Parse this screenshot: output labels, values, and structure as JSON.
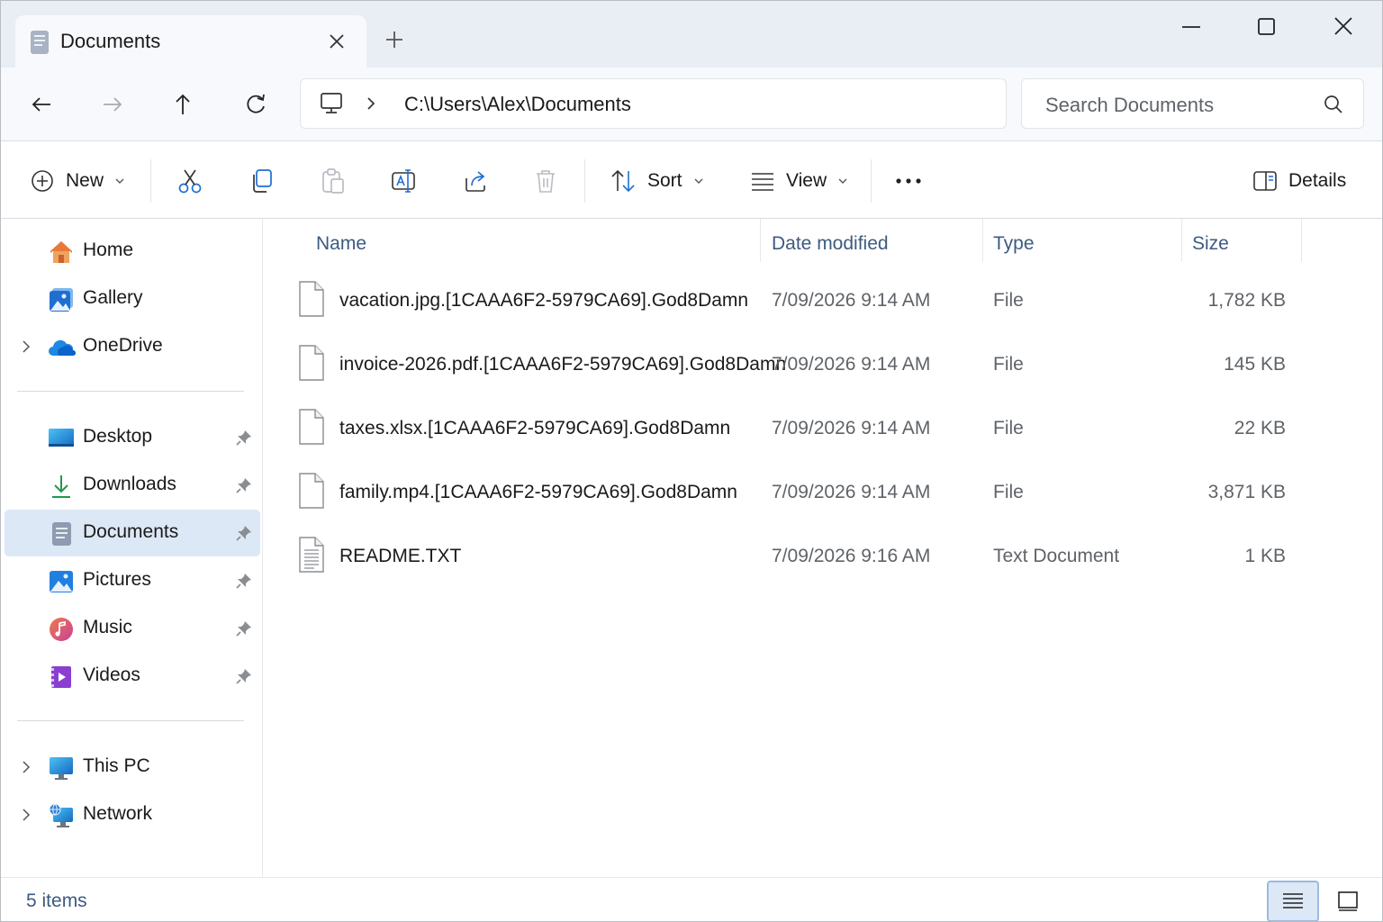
{
  "window": {
    "tab_title": "Documents",
    "tab_icon": "documents-icon",
    "controls": [
      "minimize-icon",
      "maximize-icon",
      "close-icon"
    ]
  },
  "address": {
    "path": "C:\\Users\\Alex\\Documents",
    "location_icon": "pc-icon",
    "search_placeholder": "Search Documents"
  },
  "toolbar": {
    "new_label": "New",
    "sort_label": "Sort",
    "view_label": "View",
    "details_label": "Details",
    "actions": [
      "cut-icon",
      "copy-icon",
      "paste-icon",
      "rename-icon",
      "share-icon",
      "delete-icon",
      "more-icon"
    ]
  },
  "sidebar": {
    "items": [
      {
        "label": "Home",
        "icon": "home-icon"
      },
      {
        "label": "Gallery",
        "icon": "gallery-icon"
      },
      {
        "label": "OneDrive",
        "icon": "onedrive-icon",
        "expandable": true
      },
      {
        "label": "Desktop",
        "icon": "desktop-icon",
        "pinned": true
      },
      {
        "label": "Downloads",
        "icon": "downloads-icon",
        "pinned": true
      },
      {
        "label": "Documents",
        "icon": "documents-icon",
        "pinned": true,
        "selected": true
      },
      {
        "label": "Pictures",
        "icon": "pictures-icon",
        "pinned": true
      },
      {
        "label": "Music",
        "icon": "music-icon",
        "pinned": true
      },
      {
        "label": "Videos",
        "icon": "videos-icon",
        "pinned": true
      },
      {
        "label": "This PC",
        "icon": "this-pc-icon",
        "expandable": true
      },
      {
        "label": "Network",
        "icon": "network-icon",
        "expandable": true
      }
    ]
  },
  "file_list": {
    "columns": [
      "Name",
      "Date modified",
      "Type",
      "Size"
    ],
    "rows": [
      {
        "name": "vacation.jpg.[1CAAA6F2-5979CA69].God8Damn",
        "date": "7/09/2026 9:14 AM",
        "type": "File",
        "size": "1,782 KB",
        "icon": "file-icon"
      },
      {
        "name": "invoice-2026.pdf.[1CAAA6F2-5979CA69].God8Damn",
        "date": "7/09/2026 9:14 AM",
        "type": "File",
        "size": "145 KB",
        "icon": "file-icon"
      },
      {
        "name": "taxes.xlsx.[1CAAA6F2-5979CA69].God8Damn",
        "date": "7/09/2026 9:14 AM",
        "type": "File",
        "size": "22 KB",
        "icon": "file-icon"
      },
      {
        "name": "family.mp4.[1CAAA6F2-5979CA69].God8Damn",
        "date": "7/09/2026 9:14 AM",
        "type": "File",
        "size": "3,871 KB",
        "icon": "file-icon"
      },
      {
        "name": "README.TXT",
        "date": "7/09/2026 9:16 AM",
        "type": "Text Document",
        "size": "1 KB",
        "icon": "text-document-icon"
      }
    ]
  },
  "status": {
    "item_count": "5 items",
    "active_view": "details"
  },
  "colors": {
    "titlebar_bg": "#e9edf4",
    "selected_bg": "#dde8f6",
    "header_text": "#3d5a80",
    "accent": "#1f6fd1"
  }
}
